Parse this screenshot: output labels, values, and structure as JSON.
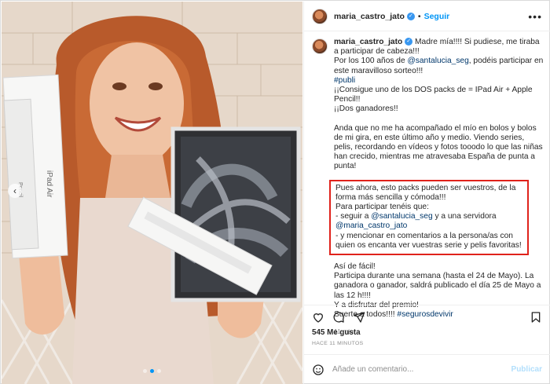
{
  "header": {
    "username": "maria_castro_jato",
    "separator": "•",
    "follow_label": "Seguir",
    "more_label": "•••"
  },
  "caption": {
    "username": "maria_castro_jato",
    "line1": " Madre mía!!!! Si pudiese, me tiraba a participar de cabeza!!!",
    "line2a": "Por los 100 años de ",
    "mention_santalucia": "@santalucia_seg",
    "line2b": ", podéis participar en este maravilloso sorteo!!!",
    "hashtag_publi": "#publi",
    "line3": "¡¡Consigue uno de los DOS packs de = IPad Air + Apple Pencil!!",
    "line4": "¡¡Dos ganadores!!",
    "para2": "Anda que no me ha acompañado el mío en bolos y bolos de mi gira, en este último año y medio. Viendo series, pelis, recordando en vídeos y fotos tooodo lo que las niñas han crecido, mientras me atravesaba España de punta a punta!",
    "boxed_line1": "Pues ahora, esto packs pueden ser vuestros, de la forma más sencilla y cómoda!!!",
    "boxed_line2": "Para participar tenéis que:",
    "boxed_line3a": "- seguir a ",
    "boxed_line3b": " y a una servidora",
    "mention_maria": "@maria_castro_jato",
    "boxed_line4": "- y mencionar en comentarios a la persona/as con quien os encanta ver vuestras serie y pelis favoritas!",
    "para4_line1": "Así de fácil!",
    "para4_line2": "Participa durante una semana (hasta el 24 de Mayo). La ganadora o ganador, saldrá publicado el día 25 de Mayo a las 12 h!!!!",
    "para4_line3": "Y a disfrutar del premio!",
    "para4_line4": "Suerte a todos!!!! ",
    "hashtag_seguros": "#segurosdevivir",
    "time": "11 min"
  },
  "stats": {
    "likes": "545 Me gusta",
    "ago": "HACE 11 MINUTOS"
  },
  "comment": {
    "placeholder": "Añade un comentario...",
    "publish_label": "Publicar"
  },
  "photo": {
    "box1_label": "iPad Air",
    "box2_label": "Pencil",
    "carousel_dots": 3,
    "carousel_active": 1
  },
  "colors": {
    "accent_blue": "#0095f6",
    "highlight_red": "#e0221b",
    "link_dark_blue": "#00376b"
  }
}
